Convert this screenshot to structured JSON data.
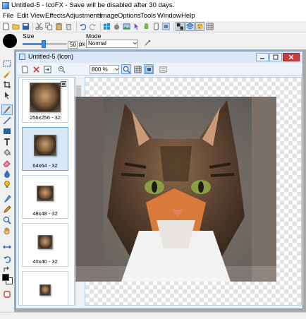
{
  "window": {
    "title": "Untitled-5 - IcoFX - Save will be disabled after 30 days."
  },
  "menu": [
    "File",
    "Edit",
    "View",
    "Effects",
    "Adjustments",
    "Image",
    "Options",
    "Tools",
    "Window",
    "Help"
  ],
  "options": {
    "size_label": "Size",
    "size_value": "50",
    "size_unit": "px",
    "mode_label": "Mode",
    "mode_value": "Normal"
  },
  "child": {
    "title": "Untitled-5 (Icon)",
    "zoom": "800 %"
  },
  "thumbnails": [
    {
      "label": "256x256 - 32",
      "selected": false
    },
    {
      "label": "64x64 - 32",
      "selected": true
    },
    {
      "label": "48x48 - 32",
      "selected": false
    },
    {
      "label": "40x40 - 32",
      "selected": false
    },
    {
      "label": "",
      "selected": false
    }
  ],
  "colors": {
    "accent": "#3a8ee6",
    "selection": "#cfe3f8",
    "close": "#c73b3b"
  }
}
